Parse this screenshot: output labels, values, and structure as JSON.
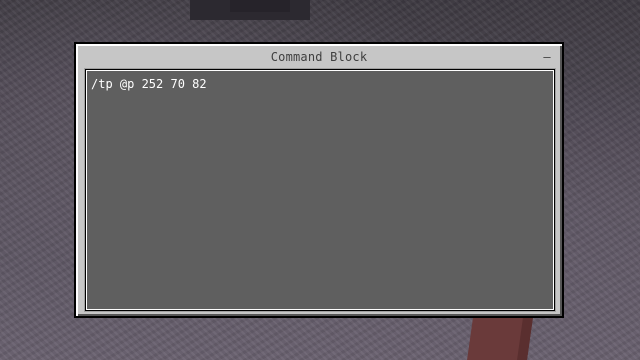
{
  "window": {
    "title": "Command Block",
    "minimize_label": "–"
  },
  "command": {
    "value": "/tp @p 252 70 82"
  },
  "colors": {
    "panel": "#c6c6c6",
    "text_area": "#5f5f5f",
    "text": "#ffffff",
    "title_text": "#3f3f3f"
  }
}
